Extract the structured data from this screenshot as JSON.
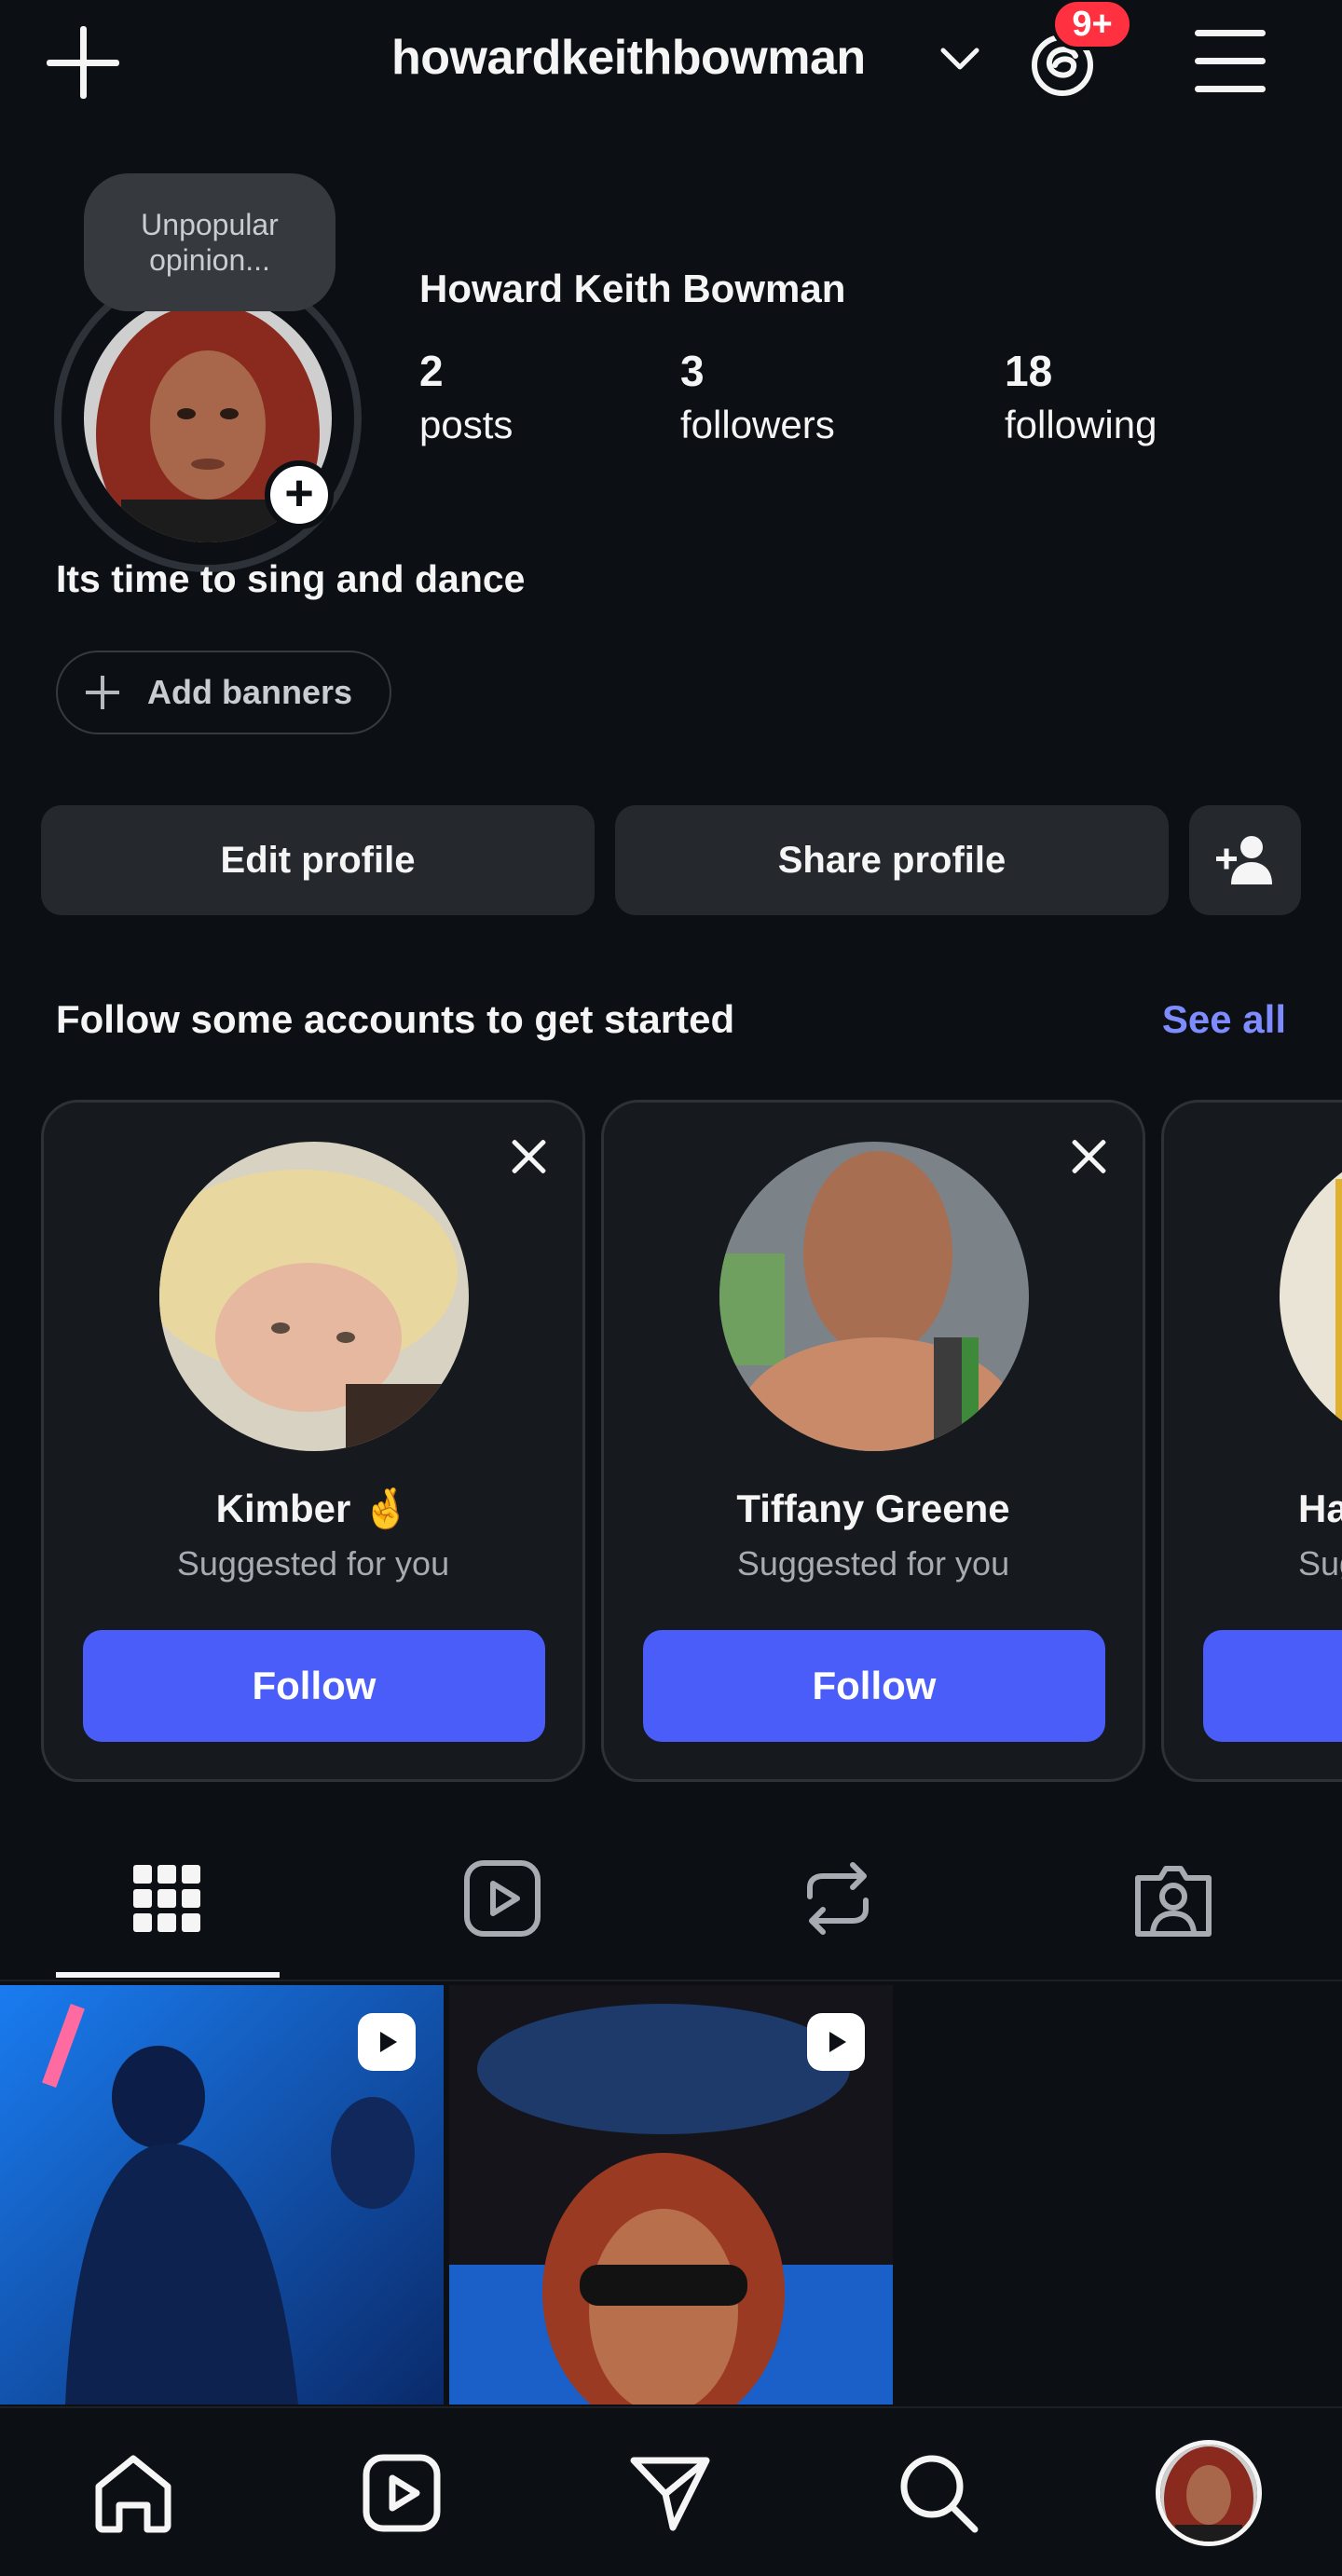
{
  "header": {
    "username": "howardkeithbowman",
    "notification_count": "9+",
    "icons": [
      "plus-icon",
      "chevron-down-icon",
      "threads-icon",
      "menu-icon"
    ]
  },
  "profile": {
    "note": "Unpopular opinion...",
    "full_name": "Howard Keith Bowman",
    "stats": [
      {
        "value": "2",
        "label": "posts"
      },
      {
        "value": "3",
        "label": "followers"
      },
      {
        "value": "18",
        "label": "following"
      }
    ],
    "bio": "Its time to sing and dance",
    "add_banners_label": "Add banners"
  },
  "actions": {
    "edit_label": "Edit profile",
    "share_label": "Share profile"
  },
  "suggestions": {
    "title": "Follow some accounts to get started",
    "see_all": "See all",
    "cards": [
      {
        "name": "Kimber 🤞",
        "subtitle": "Suggested for you",
        "button": "Follow"
      },
      {
        "name": "Tiffany Greene",
        "subtitle": "Suggested for you",
        "button": "Follow"
      },
      {
        "name": "Ha",
        "subtitle": "Sug",
        "button": ""
      }
    ]
  },
  "tabs": [
    "grid-icon",
    "reels-icon",
    "reposts-icon",
    "tagged-icon"
  ],
  "bottom_nav": [
    "home-icon",
    "reels-icon",
    "direct-icon",
    "search-icon",
    "profile-avatar"
  ],
  "colors": {
    "background": "#0c1014",
    "button": "#25292e",
    "accent": "#4a5df9",
    "link": "#7f8cff",
    "badge": "#ff3040"
  }
}
